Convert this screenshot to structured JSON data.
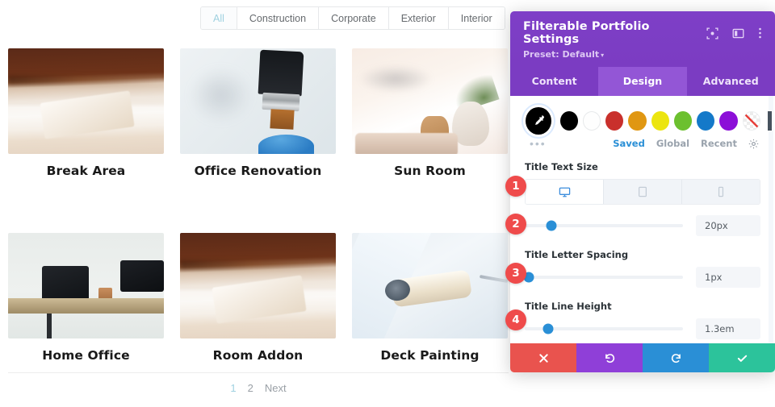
{
  "portfolio": {
    "filters": [
      {
        "label": "All",
        "active": true
      },
      {
        "label": "Construction",
        "active": false
      },
      {
        "label": "Corporate",
        "active": false
      },
      {
        "label": "Exterior",
        "active": false
      },
      {
        "label": "Interior",
        "active": false
      }
    ],
    "items": [
      {
        "title": "Break Area",
        "art": "img-wood"
      },
      {
        "title": "Office Renovation",
        "art": "img-brush"
      },
      {
        "title": "Sun Room",
        "art": "img-sun"
      },
      {
        "title": "Home Office",
        "art": "img-desk"
      },
      {
        "title": "Room Addon",
        "art": "img-wood"
      },
      {
        "title": "Deck Painting",
        "art": "img-roller"
      }
    ],
    "pagination": {
      "page1": "1",
      "page2": "2",
      "next": "Next"
    }
  },
  "modal": {
    "title": "Filterable Portfolio Settings",
    "preset": "Preset: Default",
    "preset_caret": "▾",
    "header_icons": [
      "target-icon",
      "layout-icon",
      "more-vertical-icon"
    ],
    "tabs": [
      {
        "label": "Content",
        "active": false
      },
      {
        "label": "Design",
        "active": true
      },
      {
        "label": "Advanced",
        "active": false
      }
    ],
    "color_picker": {
      "eyedropper_icon": "eyedropper-icon",
      "more_dots": "•••",
      "swatches": [
        {
          "name": "black",
          "hex": "#000000"
        },
        {
          "name": "white",
          "hex": "#ffffff"
        },
        {
          "name": "red",
          "hex": "#c9302c"
        },
        {
          "name": "orange",
          "hex": "#e09712"
        },
        {
          "name": "yellow",
          "hex": "#ece50f"
        },
        {
          "name": "green",
          "hex": "#6cc02f"
        },
        {
          "name": "blue",
          "hex": "#1479c9"
        },
        {
          "name": "purple",
          "hex": "#8c0fd8"
        },
        {
          "name": "transparent",
          "hex": "#ffffff"
        }
      ],
      "links": [
        {
          "label": "Saved",
          "active": true
        },
        {
          "label": "Global",
          "active": false
        },
        {
          "label": "Recent",
          "active": false
        }
      ],
      "settings_icon": "gear-icon"
    },
    "fields": [
      {
        "label": "Title Text Size",
        "devices": [
          {
            "name": "desktop-icon",
            "active": true
          },
          {
            "name": "tablet-icon",
            "active": false
          },
          {
            "name": "phone-icon",
            "active": false
          }
        ],
        "value": "20px",
        "slider_percent": 17
      },
      {
        "label": "Title Letter Spacing",
        "value": "1px",
        "slider_percent": 2
      },
      {
        "label": "Title Line Height",
        "value": "1.3em",
        "slider_percent": 15
      }
    ],
    "actions": [
      {
        "name": "cancel",
        "icon": "✖"
      },
      {
        "name": "undo",
        "icon": "↺"
      },
      {
        "name": "redo",
        "icon": "↻"
      },
      {
        "name": "save",
        "icon": "✔"
      }
    ]
  },
  "badges": [
    "1",
    "2",
    "3",
    "4"
  ],
  "colors": {
    "accent_purple": "#7b3cc2",
    "tab_active": "#9356d6",
    "badge_red": "#ef4b4b",
    "slider_blue": "#2a8fd6",
    "cancel": "#e9534e",
    "undo": "#8f3fd8",
    "redo": "#2a8fd6",
    "save": "#2cc39b",
    "filter_active": "#9fd1e0"
  }
}
